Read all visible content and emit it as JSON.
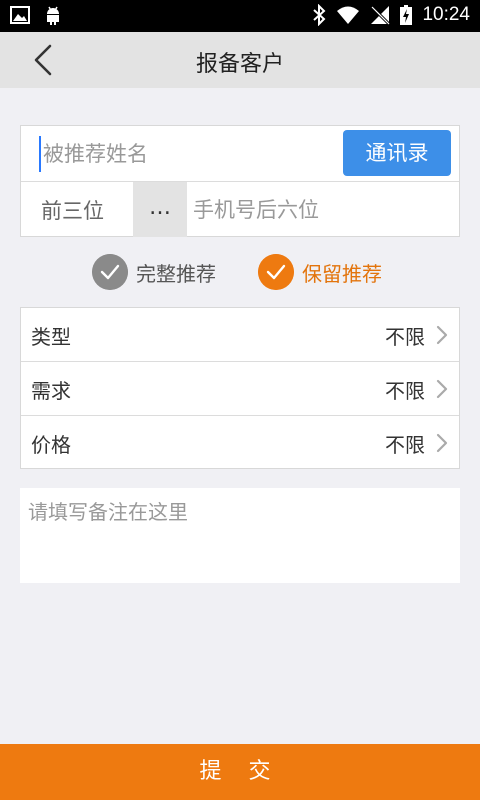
{
  "status_bar": {
    "time": "10:24",
    "left_icons": [
      "image-icon",
      "android-icon"
    ],
    "right_icons": [
      "bluetooth-icon",
      "wifi-icon",
      "no-signal-icon",
      "battery-charging-icon"
    ]
  },
  "header": {
    "title": "报备客户",
    "back_icon": "chevron-left-icon"
  },
  "form": {
    "name_placeholder": "被推荐姓名",
    "contacts_button": "通讯录",
    "phone_prefix": "前三位",
    "phone_mask": "…",
    "phone_suffix_placeholder": "手机号后六位"
  },
  "options": {
    "full": "完整推荐",
    "keep": "保留推荐"
  },
  "filters": [
    {
      "label": "类型",
      "value": "不限"
    },
    {
      "label": "需求",
      "value": "不限"
    },
    {
      "label": "价格",
      "value": "不限"
    }
  ],
  "remark_placeholder": "请填写备注在这里",
  "submit_label": "提 交",
  "colors": {
    "accent": "#ee7a10",
    "button_blue": "#3d8fe8",
    "header_bg": "#e3e3e3",
    "page_bg": "#f0f0f4"
  }
}
